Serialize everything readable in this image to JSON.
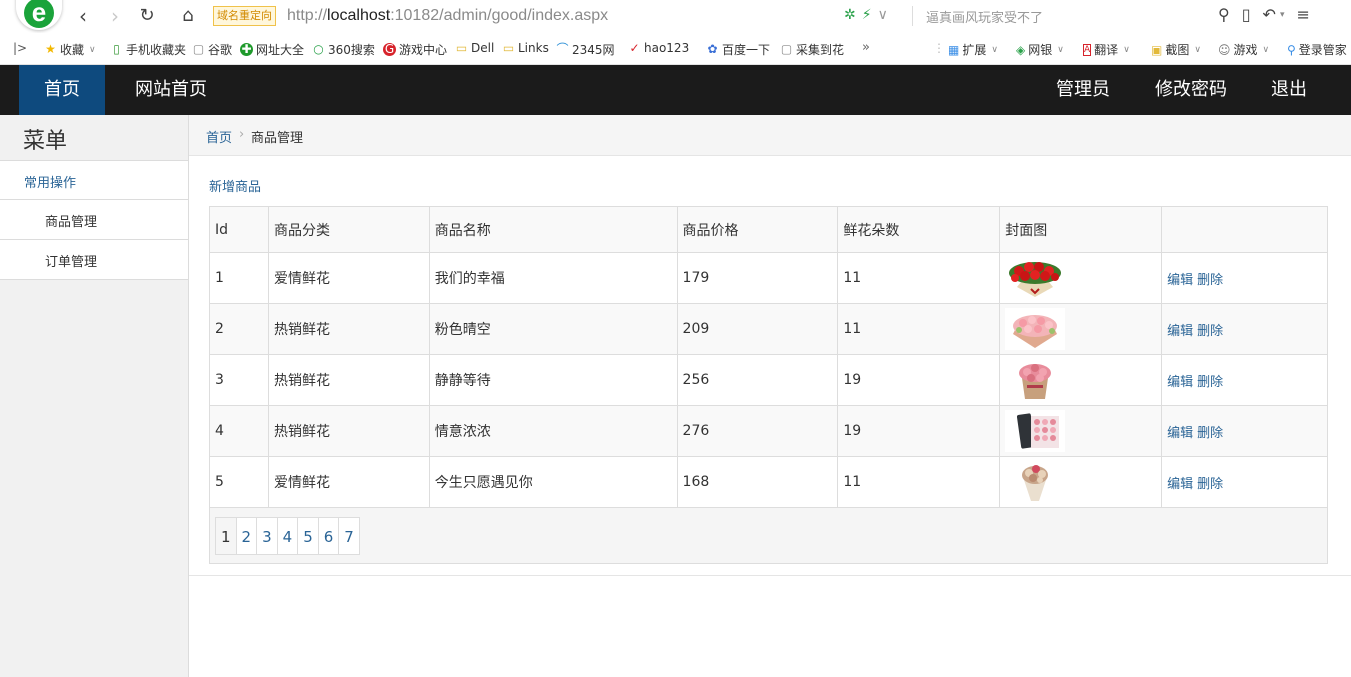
{
  "browser": {
    "redirect_badge": "域名重定向",
    "url_scheme": "http://",
    "url_host": "localhost",
    "url_rest": ":10182/admin/good/index.aspx",
    "search_hint": "逼真画风玩家受不了"
  },
  "bookmarks": [
    {
      "label": "收藏",
      "icon": "star-icon"
    },
    {
      "label": "手机收藏夹",
      "icon": "phone-icon"
    },
    {
      "label": "谷歌",
      "icon": "page-icon"
    },
    {
      "label": "网址大全",
      "icon": "navigation-icon"
    },
    {
      "label": "360搜索",
      "icon": "360-icon"
    },
    {
      "label": "游戏中心",
      "icon": "game-icon"
    },
    {
      "label": "Dell",
      "icon": "folder-icon"
    },
    {
      "label": "Links",
      "icon": "folder-icon"
    },
    {
      "label": "2345网",
      "icon": "2345-icon"
    },
    {
      "label": "hao123",
      "icon": "hao123-icon"
    },
    {
      "label": "百度一下",
      "icon": "paw-icon"
    },
    {
      "label": "采集到花",
      "icon": "page-icon"
    }
  ],
  "bookmark_more": "»",
  "browser_tools": [
    {
      "label": "扩展",
      "icon": "extension-icon"
    },
    {
      "label": "网银",
      "icon": "bank-icon"
    },
    {
      "label": "翻译",
      "icon": "translate-icon"
    },
    {
      "label": "截图",
      "icon": "screenshot-icon"
    },
    {
      "label": "游戏",
      "icon": "gamepad-icon"
    },
    {
      "label": "登录管家",
      "icon": "login-icon"
    }
  ],
  "topbar": {
    "home": "首页",
    "site_home": "网站首页",
    "admin": "管理员",
    "change_password": "修改密码",
    "logout": "退出"
  },
  "sidebar": {
    "title": "菜单",
    "group": "常用操作",
    "items": [
      "商品管理",
      "订单管理"
    ]
  },
  "breadcrumb": {
    "home": "首页",
    "sep": "›",
    "current": "商品管理"
  },
  "add_link": "新增商品",
  "table": {
    "headers": [
      "Id",
      "商品分类",
      "商品名称",
      "商品价格",
      "鲜花朵数",
      "封面图",
      ""
    ],
    "rows": [
      {
        "id": "1",
        "category": "爱情鲜花",
        "name": "我们的幸福",
        "price": "179",
        "count": "11",
        "edit": "编辑",
        "delete": "删除"
      },
      {
        "id": "2",
        "category": "热销鲜花",
        "name": "粉色晴空",
        "price": "209",
        "count": "11",
        "edit": "编辑",
        "delete": "删除"
      },
      {
        "id": "3",
        "category": "热销鲜花",
        "name": "静静等待",
        "price": "256",
        "count": "19",
        "edit": "编辑",
        "delete": "删除"
      },
      {
        "id": "4",
        "category": "热销鲜花",
        "name": "情意浓浓",
        "price": "276",
        "count": "19",
        "edit": "编辑",
        "delete": "删除"
      },
      {
        "id": "5",
        "category": "爱情鲜花",
        "name": "今生只愿遇见你",
        "price": "168",
        "count": "11",
        "edit": "编辑",
        "delete": "删除"
      }
    ],
    "pages": [
      "1",
      "2",
      "3",
      "4",
      "5",
      "6",
      "7"
    ],
    "current_page": "1"
  },
  "colors": {
    "topbar_bg": "#1b1b1b",
    "topbar_active": "#0e4a7e",
    "link": "#2a6496",
    "sidebar_bg": "#f1f1f1"
  }
}
